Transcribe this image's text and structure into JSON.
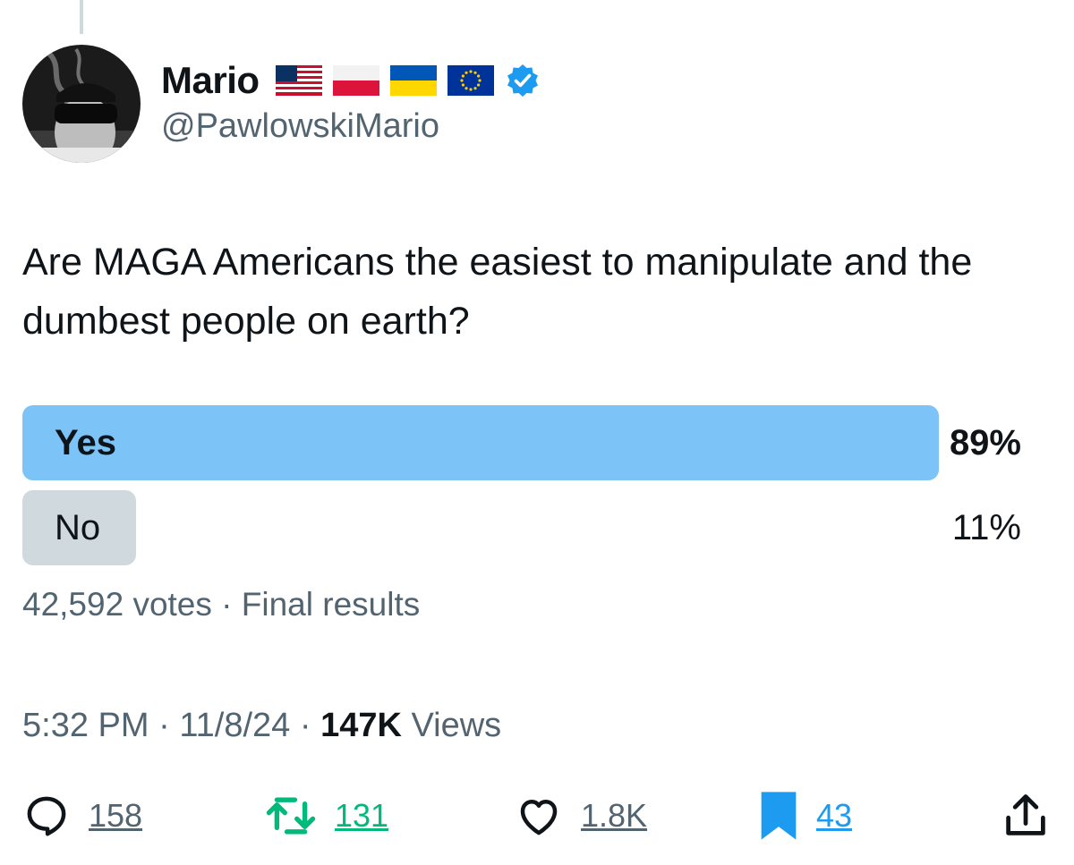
{
  "author": {
    "display_name": "Mario",
    "handle": "@PawlowskiMario",
    "name_badges": [
      "flag-usa",
      "flag-poland",
      "flag-ukraine",
      "flag-eu"
    ],
    "verified": true
  },
  "tweet": {
    "text": "Are MAGA Americans the easiest to manipulate and the dumbest people on earth?"
  },
  "poll": {
    "options": [
      {
        "label": "Yes",
        "percent_text": "89%",
        "percent": 89,
        "winner": true
      },
      {
        "label": "No",
        "percent_text": "11%",
        "percent": 11,
        "winner": false
      }
    ],
    "votes_text": "42,592 votes",
    "separator": "·",
    "status_text": "Final results"
  },
  "meta": {
    "time": "5:32 PM",
    "separator": "·",
    "date": "11/8/24",
    "views_count": "147K",
    "views_label": "Views"
  },
  "actions": {
    "replies": "158",
    "retweets": "131",
    "likes": "1.8K",
    "bookmarks": "43"
  },
  "colors": {
    "winner_bar": "#7cc3f7",
    "loser_bar": "#cfd9de",
    "secondary_text": "#536471",
    "retweet_green": "#00ba7c",
    "bookmark_blue": "#1d9bf0",
    "verified_blue": "#1d9bf0"
  }
}
